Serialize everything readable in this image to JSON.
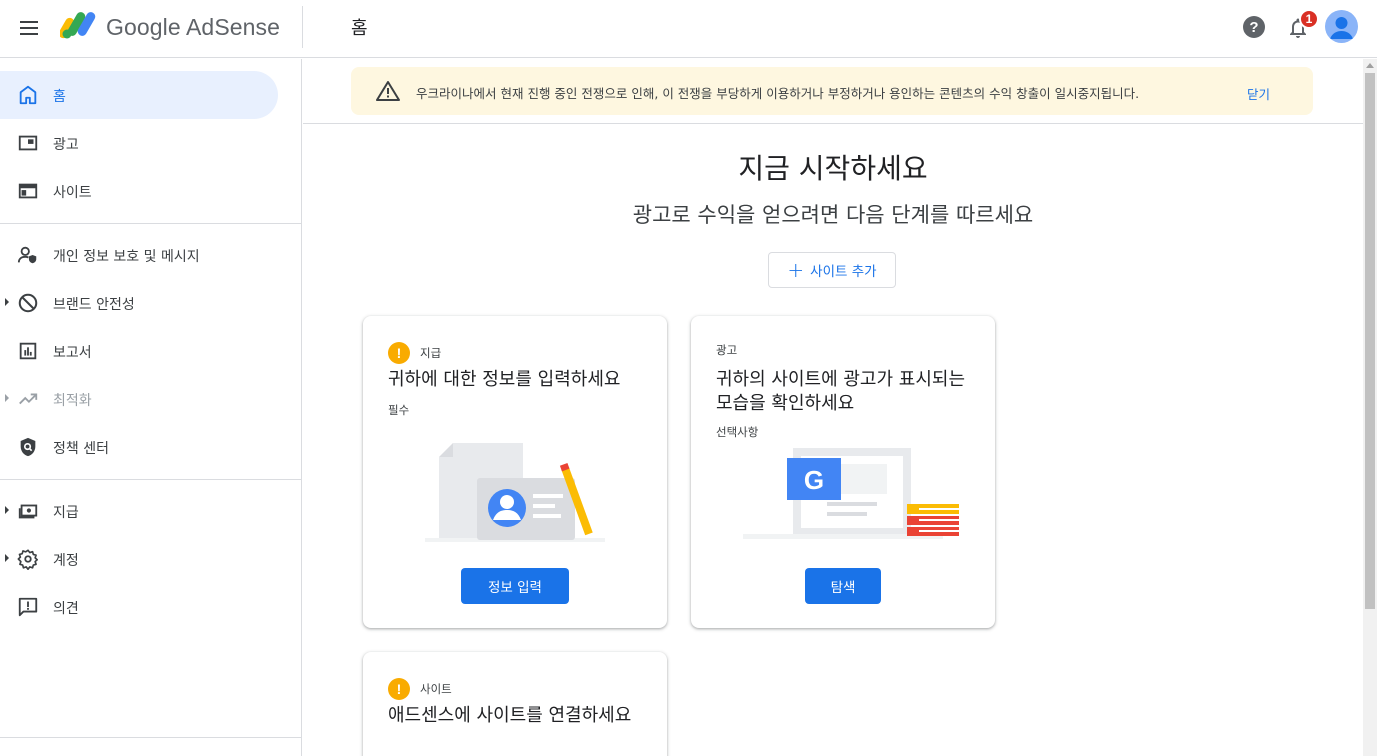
{
  "header": {
    "brand": "Google AdSense",
    "page_title": "홈",
    "notification_count": "1",
    "help_label": "?"
  },
  "sidebar": {
    "items": [
      {
        "label": "홈",
        "icon": "home-icon"
      },
      {
        "label": "광고",
        "icon": "ads-icon"
      },
      {
        "label": "사이트",
        "icon": "sites-icon"
      },
      {
        "label": "개인 정보 보호 및 메시지",
        "icon": "privacy-icon"
      },
      {
        "label": "브랜드 안전성",
        "icon": "block-icon"
      },
      {
        "label": "보고서",
        "icon": "bar-chart-icon"
      },
      {
        "label": "최적화",
        "icon": "trending-up-icon"
      },
      {
        "label": "정책 센터",
        "icon": "policy-shield-icon"
      },
      {
        "label": "지급",
        "icon": "payments-icon"
      },
      {
        "label": "계정",
        "icon": "gear-icon"
      },
      {
        "label": "의견",
        "icon": "feedback-icon"
      }
    ]
  },
  "banner": {
    "message": "우크라이나에서 현재 진행 중인 전쟁으로 인해, 이 전쟁을 부당하게 이용하거나 부정하거나 용인하는 콘텐츠의 수익 창출이 일시중지됩니다.",
    "close_label": "닫기"
  },
  "main": {
    "heading": "지금 시작하세요",
    "subheading": "광고로 수익을 얻으려면 다음 단계를 따르세요",
    "add_site_label": "사이트 추가",
    "cards": [
      {
        "tag": "지급",
        "title": "귀하에 대한 정보를 입력하세요",
        "sub": "필수",
        "button": "정보 입력"
      },
      {
        "tag": "광고",
        "title": "귀하의 사이트에 광고가 표시되는 모습을 확인하세요",
        "sub": "선택사항",
        "button": "탐색"
      },
      {
        "tag": "사이트",
        "title": "애드센스에 사이트를 연결하세요"
      }
    ]
  },
  "colors": {
    "accent": "#1a73e8",
    "active_bg": "#e8f0fe",
    "banner_bg": "#fef7e0",
    "warning": "#f9ab00",
    "badge": "#d93025"
  }
}
